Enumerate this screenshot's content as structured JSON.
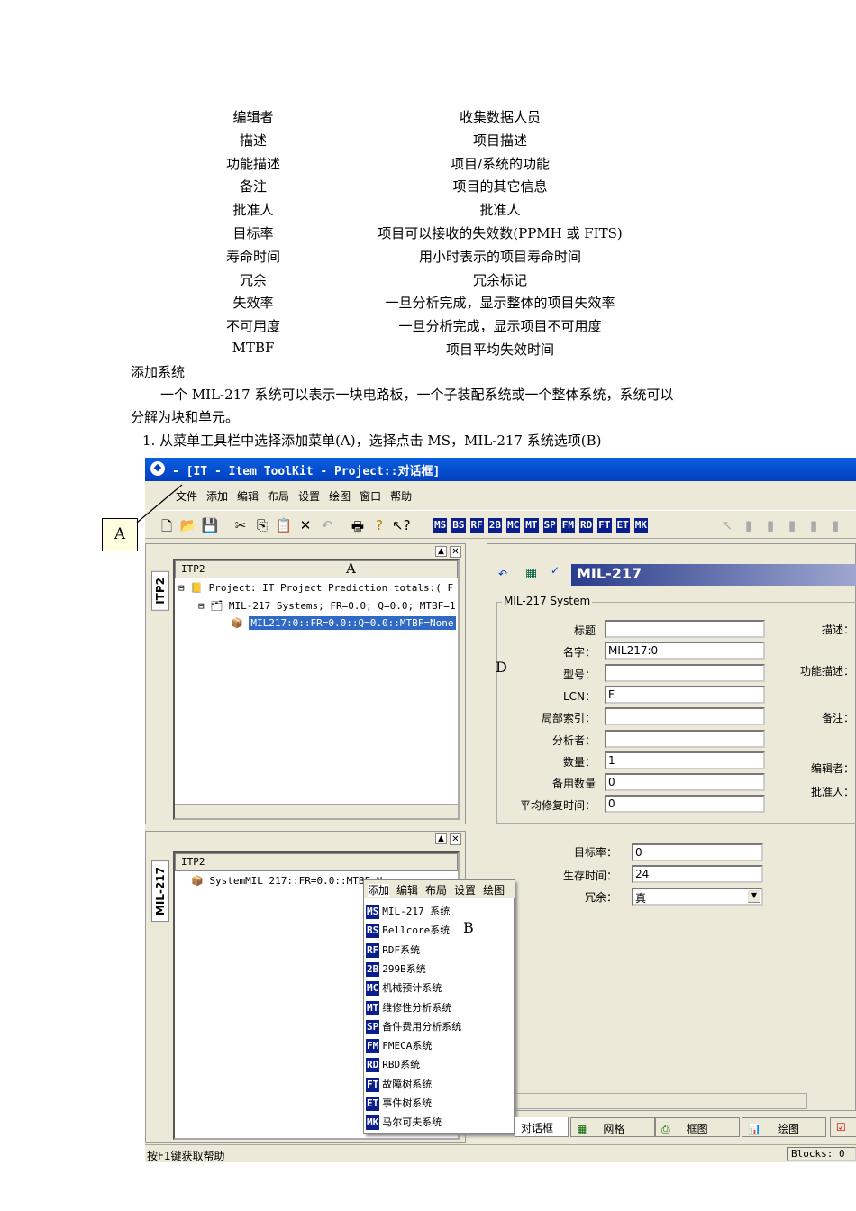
{
  "table": [
    [
      "编辑者",
      "收集数据人员"
    ],
    [
      "描述",
      "项目描述"
    ],
    [
      "功能描述",
      "项目/系统的功能"
    ],
    [
      "备注",
      "项目的其它信息"
    ],
    [
      "批准人",
      "批准人"
    ],
    [
      "目标率",
      "项目可以接收的失效数(PPMH 或 FITS)"
    ],
    [
      "寿命时间",
      "用小时表示的项目寿命时间"
    ],
    [
      "冗余",
      "冗余标记"
    ],
    [
      "失效率",
      "一旦分析完成，显示整体的项目失效率"
    ],
    [
      "不可用度",
      "一旦分析完成，显示项目不可用度"
    ],
    [
      "MTBF",
      "项目平均失效时间"
    ]
  ],
  "section_title": "添加系统",
  "paragraph_line1": "一个 MIL-217 系统可以表示一块电路板，一个子装配系统或一个整体系统，系统可以",
  "paragraph_line2": "分解为块和单元。",
  "step1": "1. 从菜单工具栏中选择添加菜单(A)，选择点击 MS，MIL-217 系统选项(B)",
  "callouts": {
    "a": "A",
    "a_tree": "A",
    "b": "B",
    "d": "D"
  },
  "window": {
    "title": "- [IT - Item ToolKit - Project::对话框]",
    "menu": [
      "文件",
      "添加",
      "编辑",
      "布局",
      "设置",
      "绘图",
      "窗口",
      "帮助"
    ],
    "toolbar_codes": [
      "MS",
      "BS",
      "RF",
      "2B",
      "MC",
      "MT",
      "SP",
      "FM",
      "RD",
      "FT",
      "ET",
      "MK"
    ],
    "top_pane": {
      "tab": "ITP2",
      "header": "ITP2",
      "project": "Project:  IT Project Prediction totals:( F",
      "systems": "MIL-217 Systems;  FR=0.0; Q=0.0; MTBF=1",
      "selected": "MIL217:0::FR=0.0::Q=0.0::MTBF=None"
    },
    "bottom_pane": {
      "tab": "MIL-217",
      "header": "ITP2",
      "item": "SystemMIL 217::FR=0.0::MTBF=None"
    },
    "popup": {
      "menubar": [
        "添加",
        "编辑",
        "布局",
        "设置",
        "绘图"
      ],
      "items": [
        [
          "MS",
          "MIL-217 系统"
        ],
        [
          "BS",
          "Bellcore系统"
        ],
        [
          "RF",
          "RDF系统"
        ],
        [
          "2B",
          "299B系统"
        ],
        [
          "MC",
          "机械预计系统"
        ],
        [
          "MT",
          "维修性分析系统"
        ],
        [
          "SP",
          "备件费用分析系统"
        ],
        [
          "FM",
          "FMECA系统"
        ],
        [
          "RD",
          "RBD系统"
        ],
        [
          "FT",
          "故障树系统"
        ],
        [
          "ET",
          "事件树系统"
        ],
        [
          "MK",
          "马尔可夫系统"
        ]
      ]
    },
    "form": {
      "header": "MIL-217",
      "group": "MIL-217 System",
      "fields": [
        [
          "标题",
          ""
        ],
        [
          "名字：",
          "MIL217:0"
        ],
        [
          "型号：",
          ""
        ],
        [
          "LCN：",
          "F"
        ],
        [
          "局部索引：",
          ""
        ],
        [
          "分析者：",
          ""
        ],
        [
          "数量：",
          "1"
        ],
        [
          "备用数量",
          "0"
        ],
        [
          "平均修复时间：",
          "0"
        ]
      ],
      "right_labels": [
        "描述：",
        "功能描述：",
        "备注：",
        "编辑者：",
        "批准人："
      ],
      "target_label": "目标率：",
      "target": "0",
      "life_label": "生存时间：",
      "life": "24",
      "redundant_label": "冗余：",
      "redundant": "真"
    },
    "bottom_tabs": [
      "对话框",
      "网格",
      "框图",
      "绘图"
    ],
    "status_left": "按F1键获取帮助",
    "status_right": "Blocks: 0"
  }
}
